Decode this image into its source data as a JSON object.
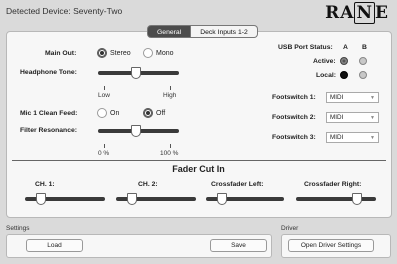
{
  "header": {
    "device_label": "Detected Device: Seventy-Two",
    "logo_left": "RA",
    "logo_boxed": "N",
    "logo_right": "E"
  },
  "tabs": [
    {
      "label": "General",
      "active": true
    },
    {
      "label": "Deck Inputs 1-2",
      "active": false
    }
  ],
  "main_out": {
    "label": "Main Out:",
    "options": [
      "Stereo",
      "Mono"
    ],
    "selected": "Stereo"
  },
  "headphone_tone": {
    "label": "Headphone Tone:",
    "min_label": "Low",
    "max_label": "High",
    "value_fraction": 0.45
  },
  "mic_clean_feed": {
    "label": "Mic 1 Clean Feed:",
    "options": [
      "On",
      "Off"
    ],
    "selected": "Off"
  },
  "filter_resonance": {
    "label": "Filter Resonance:",
    "min_label": "0 %",
    "max_label": "100 %",
    "value_fraction": 0.45
  },
  "usb_status": {
    "label": "USB Port Status:",
    "col_a": "A",
    "col_b": "B",
    "rows": [
      {
        "label": "Active:",
        "a": "active",
        "b": "off"
      },
      {
        "label": "Local:",
        "a": "dark",
        "b": "off"
      }
    ]
  },
  "footswitches": [
    {
      "label": "Footswitch 1:",
      "value": "MIDI"
    },
    {
      "label": "Footswitch 2:",
      "value": "MIDI"
    },
    {
      "label": "Footswitch 3:",
      "value": "MIDI"
    }
  ],
  "fader_cut_in": {
    "title": "Fader Cut In",
    "faders": [
      {
        "label": "CH. 1:",
        "value_fraction": 0.1
      },
      {
        "label": "CH. 2:",
        "value_fraction": 0.1
      },
      {
        "label": "Crossfader Left:",
        "value_fraction": 0.1
      },
      {
        "label": "Crossfader Right:",
        "value_fraction": 0.9
      }
    ]
  },
  "settings": {
    "group_label": "Settings",
    "load_label": "Load",
    "save_label": "Save"
  },
  "driver": {
    "group_label": "Driver",
    "open_label": "Open Driver Settings"
  },
  "colors": {
    "tab_active": "#4c4c4c",
    "track": "#3a3a3a",
    "background": "#dadada",
    "panel": "#f7f7f7"
  }
}
